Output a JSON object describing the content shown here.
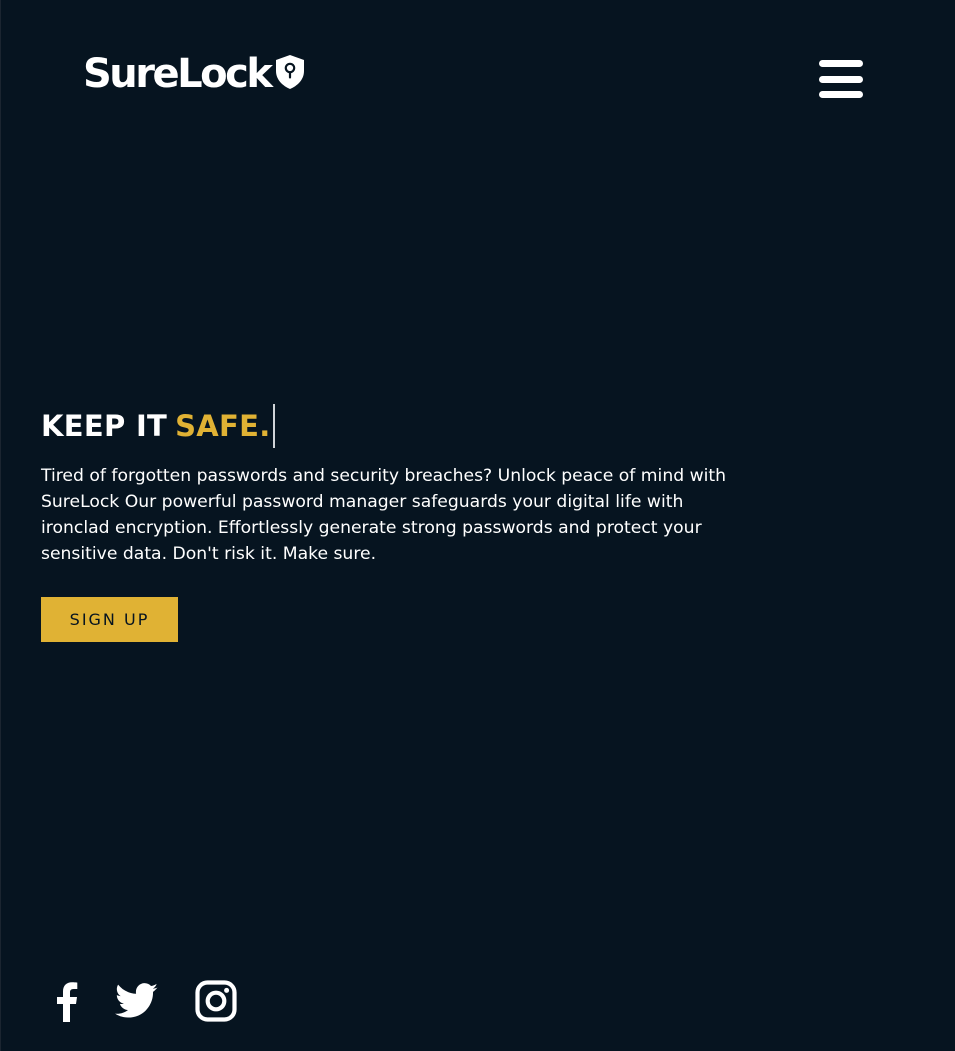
{
  "header": {
    "brand": "SureLock",
    "logo_icon": "shield-keyhole-icon",
    "menu_icon": "hamburger-menu-icon"
  },
  "hero": {
    "headline_prefix": "KEEP IT",
    "headline_accent": "SAFE.",
    "description": "Tired of forgotten passwords and security breaches? Unlock peace of mind with SureLock Our powerful password manager safeguards your digital life with ironclad encryption. Effortlessly generate strong passwords and protect your sensitive data. Don't risk it. Make sure.",
    "cta_label": "SIGN UP"
  },
  "social": {
    "links": [
      "facebook-icon",
      "twitter-icon",
      "instagram-icon"
    ]
  },
  "colors": {
    "background": "#061420",
    "accent": "#e0b234",
    "text": "#ffffff"
  }
}
